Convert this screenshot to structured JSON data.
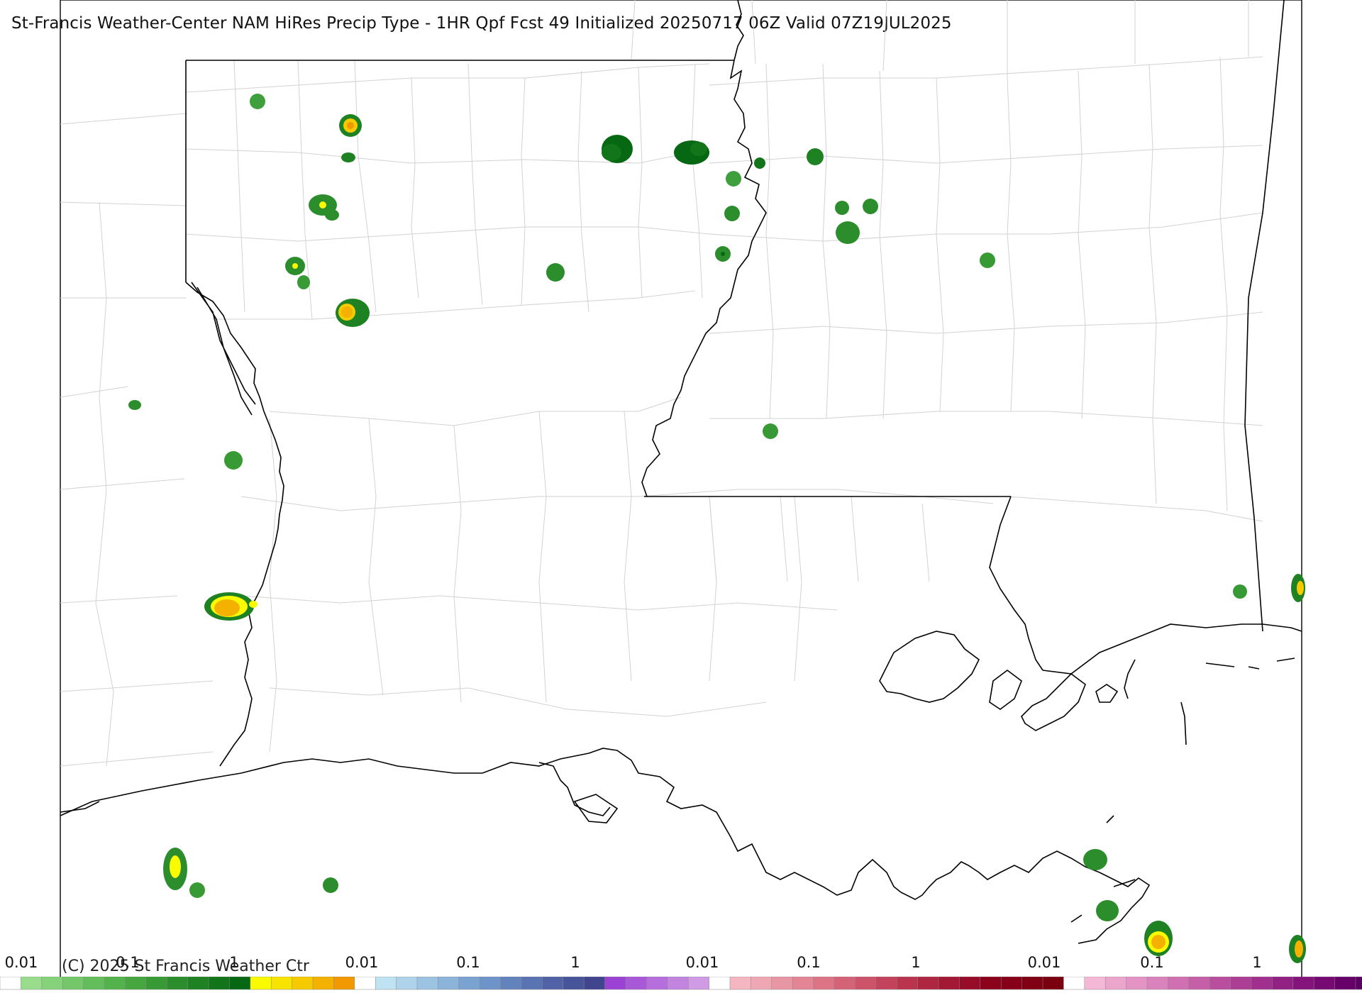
{
  "title": "St-Francis Weather-Center NAM HiRes Precip Type - 1HR Qpf Fcst 49 Initialized 20250717 06Z Valid 07Z19JUL2025",
  "copyright": "(C) 2025 St Francis Weather Ctr",
  "legend": {
    "groups": [
      {
        "type": "rain",
        "labels": [
          "0.01",
          "0.1",
          "1"
        ],
        "colors": [
          "#ffffff",
          "#98dc8c",
          "#85d27a",
          "#74c86a",
          "#63bd5b",
          "#54b24d",
          "#46a640",
          "#389a35",
          "#2b8d2b",
          "#1e8122",
          "#12751a",
          "#066812",
          "#fafa00",
          "#f8e200",
          "#f6ca00",
          "#f4b100",
          "#f29900"
        ]
      },
      {
        "type": "snow",
        "labels": [
          "0.01",
          "0.1",
          "1"
        ],
        "colors": [
          "#ffffff",
          "#bfe3f2",
          "#aed3ea",
          "#9dc3e2",
          "#8cb3da",
          "#7ba3d2",
          "#6d93c8",
          "#6383bd",
          "#5a73b2",
          "#5163a6",
          "#48549a",
          "#40458d",
          "#9b42d4",
          "#a958d8",
          "#b66edc",
          "#c384e0",
          "#d09ae4"
        ]
      },
      {
        "type": "freezing-rain",
        "labels": [
          "0.01",
          "0.1",
          "1"
        ],
        "colors": [
          "#ffffff",
          "#f4b7c2",
          "#efa7b3",
          "#e996a4",
          "#e38595",
          "#dc7486",
          "#d56378",
          "#cd536a",
          "#c4435c",
          "#ba344e",
          "#af2641",
          "#a31834",
          "#970c28",
          "#8b021d",
          "#850018",
          "#800013",
          "#7a000f"
        ]
      },
      {
        "type": "ice-pellets",
        "labels": [
          "0.01",
          "0.1",
          "1"
        ],
        "colors": [
          "#ffffff",
          "#f4b8d6",
          "#eca6cd",
          "#e394c4",
          "#da82bb",
          "#d070b2",
          "#c55fa8",
          "#b94e9f",
          "#ad3e96",
          "#a02f8d",
          "#922184",
          "#84147b",
          "#760972",
          "#68006a",
          "#5c0064",
          "#51005e",
          "#470058"
        ]
      }
    ]
  }
}
